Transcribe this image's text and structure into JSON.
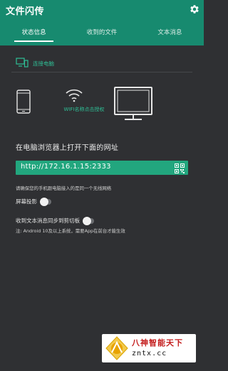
{
  "app": {
    "title": "文件闪传",
    "header_color": "#178a6f",
    "accent_color": "#2fbf96",
    "settings_icon": "gear-icon"
  },
  "tabs": [
    {
      "label": "状态信息",
      "active": true
    },
    {
      "label": "收到的文件",
      "active": false
    },
    {
      "label": "文本消息",
      "active": false
    }
  ],
  "status": {
    "connect_pc_label": "连接电脑",
    "connect_pc_icon": "monitor-connect-icon",
    "wifi_auth_label": "WIFI名称点击授权",
    "url_heading": "在电脑浏览器上打开下面的网址",
    "url": "http://172.16.1.15:2333",
    "qr_icon": "qr-code-icon",
    "network_hint": "请确保您的手机跟电脑接入的是同一个无线网络",
    "screen_projection_label": "屏幕投影",
    "screen_projection_enabled": false,
    "clipboard_sync_label": "收到文本消息同步到剪切板",
    "clipboard_sync_enabled": false,
    "android_note": "注: Android 10及以上系统，需要App在前台才能生效"
  },
  "watermark": {
    "title": "八神智能天下",
    "url": "zntx.cc"
  }
}
